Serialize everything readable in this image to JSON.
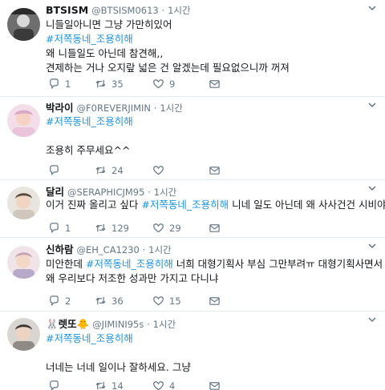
{
  "tweets": [
    {
      "name": "BTSISM",
      "handle": "@BTSISM0613",
      "dot": "·",
      "time": "1시간",
      "lines": [
        {
          "text": "니들일아니면 그냥 가만히있어"
        },
        {
          "tag": "#저쪽동네_조용히해"
        },
        {
          "text": "왜 니들일도 아닌데 참견해,,"
        },
        {
          "text": "견제하는 거나 오지랖 넓은 건 알겠는데 필요없으니까 꺼져"
        }
      ],
      "reply_count": "1",
      "retweet_count": "35",
      "like_count": "9"
    },
    {
      "name": "박라이",
      "handle": "@F0REVERJIMIN",
      "dot": "·",
      "time": "1시간",
      "lines": [
        {
          "tag": "#저쪽동네_조용히해"
        },
        {
          "text": ""
        },
        {
          "text": "조용히 주무세요^^"
        }
      ],
      "reply_count": "",
      "retweet_count": "24",
      "like_count": ""
    },
    {
      "name": "달리",
      "handle": "@SERAPHICJM95",
      "dot": "·",
      "time": "1시간",
      "lines": [
        {
          "pre": "이거 진짜 올리고 싶다 ",
          "tag": "#저쪽동네_조용히해",
          "post": " 니네 일도 아닌데 왜 사사건건 시비야"
        }
      ],
      "reply_count": "1",
      "retweet_count": "129",
      "like_count": "29"
    },
    {
      "name": "신하람",
      "handle": "@EH_CA1230",
      "dot": "·",
      "time": "1시간",
      "lines": [
        {
          "pre": "미안한데 ",
          "tag": "#저쪽동네_조용히해",
          "post": " 너희 대형기획사 부심 그만부려ㅠ 대형기획사면서"
        },
        {
          "text": "왜 우리보다 저조한 성과만 가지고 다니냐"
        }
      ],
      "reply_count": "2",
      "retweet_count": "36",
      "like_count": "15"
    },
    {
      "name": "🐰렛또🐥",
      "handle": "@JIMINI95s",
      "dot": "·",
      "time": "1시간",
      "lines": [
        {
          "tag": "#저쪽동네_조용히해"
        },
        {
          "text": ""
        },
        {
          "text": "너네는 너네 일이나 잘하세요. 그냥"
        }
      ],
      "reply_count": "",
      "retweet_count": "14",
      "like_count": "4"
    }
  ]
}
